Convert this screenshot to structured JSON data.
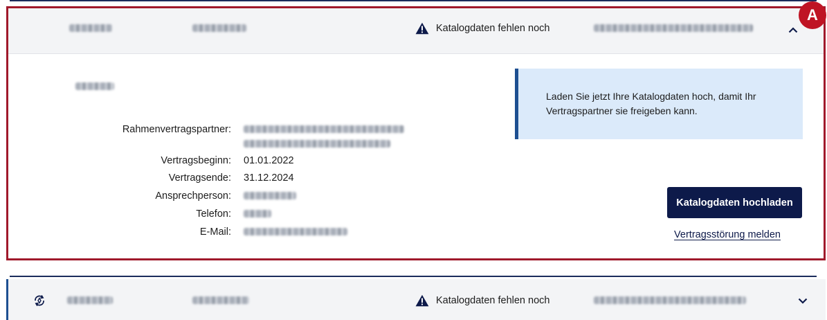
{
  "badge": "A",
  "expanded_row": {
    "status": "Katalogdaten fehlen noch",
    "details": {
      "labels": {
        "partner": "Rahmenvertragspartner:",
        "start": "Vertragsbeginn:",
        "end": "Vertragsende:",
        "contact": "Ansprechperson:",
        "phone": "Telefon:",
        "email": "E-Mail:"
      },
      "values": {
        "start": "01.01.2022",
        "end": "31.12.2024"
      }
    },
    "info_text": "Laden Sie jetzt Ihre Katalogdaten hoch, damit Ihr Vertragspartner sie freigeben kann.",
    "upload_button": "Katalogdaten hochladen",
    "report_link": "Vertragsstörung melden"
  },
  "collapsed_row": {
    "status": "Katalogdaten fehlen noch"
  },
  "colors": {
    "highlight_border": "#a0192b",
    "primary": "#0d1a4a",
    "info_bg": "#dbeafa",
    "info_accent": "#1d4f91"
  },
  "icons": {
    "warning": "warning-triangle-icon",
    "chevron_up": "chevron-up-icon",
    "chevron_down": "chevron-down-icon",
    "sync": "sync-icon"
  }
}
